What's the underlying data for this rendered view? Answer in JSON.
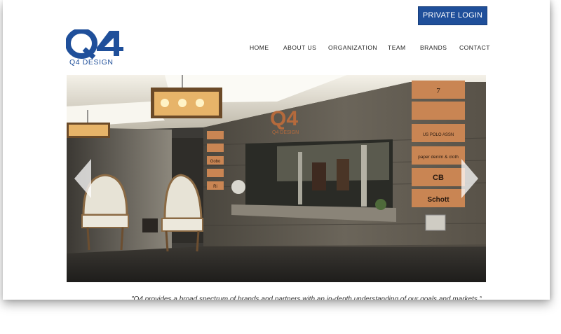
{
  "header": {
    "login_label": "PRIVATE LOGIN",
    "logo_mark": "Q4",
    "logo_text": "Q4 DESIGN"
  },
  "nav": {
    "items": [
      {
        "label": "HOME"
      },
      {
        "label": "ABOUT US"
      },
      {
        "label": "ORGANIZATION"
      },
      {
        "label": "TEAM"
      },
      {
        "label": "BRANDS"
      },
      {
        "label": "CONTACT"
      }
    ]
  },
  "hero": {
    "wall_logo": "Q4",
    "wall_sub": "Q4 DESIGN",
    "brand_plaques": [
      "7",
      "",
      "US POLO ASSN",
      "paper denim & cloth",
      "CB",
      "Schott"
    ],
    "side_plaques": [
      "",
      "",
      "Gobo",
      "",
      "Ri"
    ],
    "prev_icon": "chevron-left-icon",
    "next_icon": "chevron-right-icon"
  },
  "quote": {
    "text": "\"Q4 provides a broad spectrum of brands and partners with an in-depth understanding of our goals and markets.\""
  }
}
